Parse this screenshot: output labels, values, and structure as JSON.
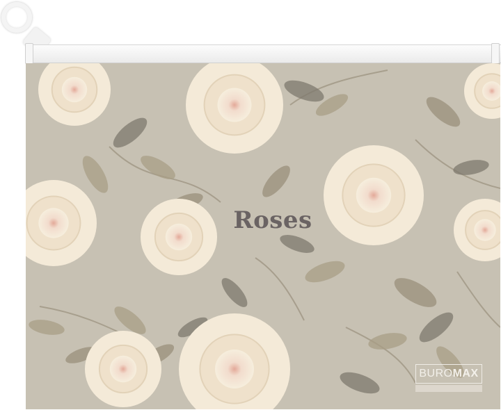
{
  "folder": {
    "title": "Roses",
    "brand": {
      "part1": "BURO",
      "part2": "MAX"
    }
  },
  "colors": {
    "background": "#c7c1b3",
    "rose_petal": "#f4ead8",
    "rose_center": "#e3a999",
    "leaf": "#8c8577",
    "title_text": "#6a6363"
  },
  "icons": [
    "zipper-pull-ring-icon",
    "rose-pattern-icon",
    "buromax-logo-icon"
  ]
}
